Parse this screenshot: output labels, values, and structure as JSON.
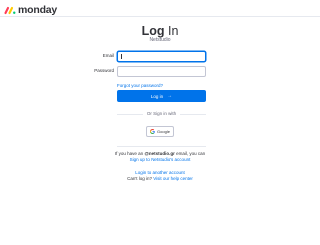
{
  "brand": {
    "logo_text": "monday",
    "colors": {
      "red": "#ff3d57",
      "yellow": "#ffcb00",
      "green": "#00ca72"
    }
  },
  "title": {
    "bold": "Log",
    "rest": " In"
  },
  "subtitle": "Netstudio",
  "form": {
    "email_label": "Email",
    "email_value": "",
    "password_label": "Password",
    "password_value": "",
    "forgot_link": "Forgot your password?",
    "login_button": "Log in",
    "login_arrow_icon": "arrow-right-icon"
  },
  "social": {
    "or_text": "Or Sign in with",
    "google_label": "Google",
    "google_icon": "google-icon"
  },
  "footer": {
    "domain_prefix": "If you have an ",
    "domain_bold": "@netstudio.gr",
    "domain_suffix": " email, you can",
    "signup_link": "Sign up to Netstudio's account",
    "another_account_link": "Login to another account",
    "help_prefix": "Can't log in? ",
    "help_link": "Visit our help center"
  },
  "theme": {
    "primary": "#0073ea",
    "text": "#323338",
    "muted": "#676879",
    "border": "#c3c6d4"
  }
}
